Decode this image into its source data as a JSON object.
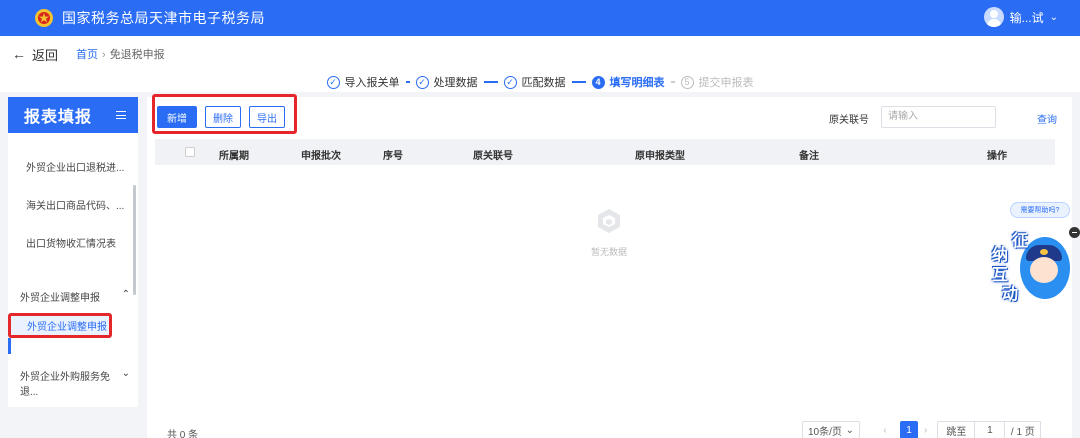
{
  "header": {
    "title": "国家税务总局天津市电子税务局",
    "user_name": "输...试"
  },
  "nav": {
    "back_label": "返回",
    "breadcrumb_home": "首页",
    "breadcrumb_separator": "›",
    "breadcrumb_current": "免退税申报"
  },
  "stepper": {
    "steps": [
      {
        "icon": "✓",
        "label": "导入报关单",
        "state": "done"
      },
      {
        "icon": "✓",
        "label": "处理数据",
        "state": "done"
      },
      {
        "icon": "✓",
        "label": "匹配数据",
        "state": "done"
      },
      {
        "icon": "4",
        "label": "填写明细表",
        "state": "active"
      },
      {
        "icon": "5",
        "label": "提交申报表",
        "state": "future"
      }
    ]
  },
  "sidebar": {
    "title": "报表填报",
    "items": [
      "外贸企业出口退税进...",
      "海关出口商品代码、...",
      "出口货物收汇情况表"
    ],
    "group1": "外贸企业调整申报",
    "active_item": "外贸企业调整申报",
    "group2": "外贸企业外购服务免退..."
  },
  "toolbar": {
    "add_label": "新增",
    "delete_label": "删除",
    "export_label": "导出",
    "filter_label": "原关联号",
    "filter_placeholder": "请输入",
    "query_label": "查询"
  },
  "table": {
    "columns": [
      "所属期",
      "申报批次",
      "序号",
      "原关联号",
      "原申报类型",
      "备注",
      "操作"
    ],
    "rows": [],
    "empty_text": "暂无数据"
  },
  "pagination": {
    "total_text": "共 0 条",
    "page_size": "10条/页",
    "current_page": "1",
    "goto_label": "跳至",
    "goto_value": "1",
    "total_pages": "/ 1 页"
  },
  "help": {
    "bubble_text": "需要帮助吗?",
    "mascot_chars": [
      "征",
      "纳",
      "互",
      "动"
    ]
  },
  "colors": {
    "primary": "#2a6df4",
    "highlight_border": "#e5262b"
  }
}
